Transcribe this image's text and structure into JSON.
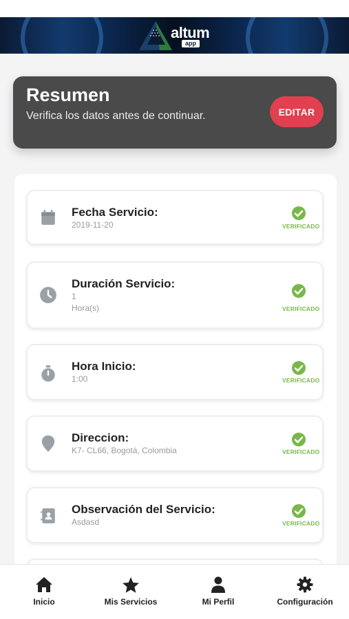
{
  "brand": {
    "name": "altum",
    "sub": "app"
  },
  "summary": {
    "title": "Resumen",
    "subtitle": "Verifica los datos antes de continuar.",
    "edit_label": "EDITAR"
  },
  "items": [
    {
      "label": "Fecha Servicio:",
      "value": "2019-11-20",
      "value2": "",
      "icon": "calendar-icon",
      "status": "VERIFICADO"
    },
    {
      "label": "Duración Servicio:",
      "value": "1",
      "value2": "Hora(s)",
      "icon": "clock-icon",
      "status": "VERIFICADO"
    },
    {
      "label": "Hora Inicio:",
      "value": "1:00",
      "value2": "",
      "icon": "stopwatch-icon",
      "status": "VERIFICADO"
    },
    {
      "label": "Direccion:",
      "value": "K7- CL66, Bogotá, Colombia",
      "value2": "",
      "icon": "location-pin-icon",
      "status": "VERIFICADO"
    },
    {
      "label": "Observación del Servicio:",
      "value": "Asdasd",
      "value2": "",
      "icon": "contact-book-icon",
      "status": "VERIFICADO"
    }
  ],
  "nav": [
    {
      "label": "Inicio",
      "icon": "home-icon"
    },
    {
      "label": "Mis Servicios",
      "icon": "star-icon"
    },
    {
      "label": "Mi Perfil",
      "icon": "user-icon"
    },
    {
      "label": "Configuración",
      "icon": "gear-icon"
    }
  ],
  "colors": {
    "accent": "#e0404f",
    "verified": "#78b84a",
    "card_header": "#4a4a4a",
    "icon_gray": "#9aa0a6"
  }
}
